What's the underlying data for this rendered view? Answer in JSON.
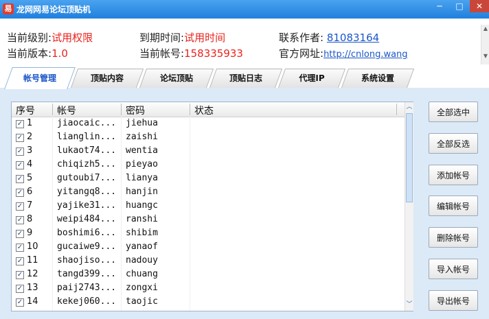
{
  "window": {
    "title": "龙网网易论坛顶贴机",
    "icon": "app-logo-icon"
  },
  "info": {
    "level_label": "当前级别:",
    "level_value": "试用权限",
    "expire_label": "到期时间:",
    "expire_value": "试用时间",
    "author_label": "联系作者:",
    "author_value": "81083164",
    "version_label": "当前版本:",
    "version_value": "1.0",
    "account_label": "当前帐号:",
    "account_value": "158335933",
    "site_label": "官方网址:",
    "site_value": "http://cnlong.wang"
  },
  "tabs": [
    "帐号管理",
    "顶贴内容",
    "论坛顶贴",
    "顶贴日志",
    "代理IP",
    "系统设置"
  ],
  "table": {
    "headers": [
      "序号",
      "帐号",
      "密码",
      "状态"
    ],
    "rows": [
      {
        "seq": "1",
        "account": "jiaocaic...",
        "password": "jiehua",
        "status": ""
      },
      {
        "seq": "2",
        "account": "lianglin...",
        "password": "zaishi",
        "status": ""
      },
      {
        "seq": "3",
        "account": "lukaot74...",
        "password": "wentia",
        "status": ""
      },
      {
        "seq": "4",
        "account": "chiqizh5...",
        "password": "pieyao",
        "status": ""
      },
      {
        "seq": "5",
        "account": "gutoubi7...",
        "password": "lianya",
        "status": ""
      },
      {
        "seq": "6",
        "account": "yitangq8...",
        "password": "hanjin",
        "status": ""
      },
      {
        "seq": "7",
        "account": "yajike31...",
        "password": "huangc",
        "status": ""
      },
      {
        "seq": "8",
        "account": "weipi484...",
        "password": "ranshi",
        "status": ""
      },
      {
        "seq": "9",
        "account": "boshimi6...",
        "password": "shibim",
        "status": ""
      },
      {
        "seq": "10",
        "account": "gucaiwe9...",
        "password": "yanaof",
        "status": ""
      },
      {
        "seq": "11",
        "account": "shaojiso...",
        "password": "nadouy",
        "status": ""
      },
      {
        "seq": "12",
        "account": "tangd399...",
        "password": "chuang",
        "status": ""
      },
      {
        "seq": "13",
        "account": "paij2743...",
        "password": "zongxi",
        "status": ""
      },
      {
        "seq": "14",
        "account": "kekej060...",
        "password": "taojic",
        "status": ""
      }
    ]
  },
  "buttons": [
    "全部选中",
    "全部反选",
    "添加帐号",
    "编辑帐号",
    "删除帐号",
    "导入帐号",
    "导出帐号"
  ],
  "colors": {
    "title_bar": "#2a8be6",
    "highlight_red": "#e8231d",
    "link_blue": "#1a56c8",
    "panel_bg": "#dce9f7"
  }
}
